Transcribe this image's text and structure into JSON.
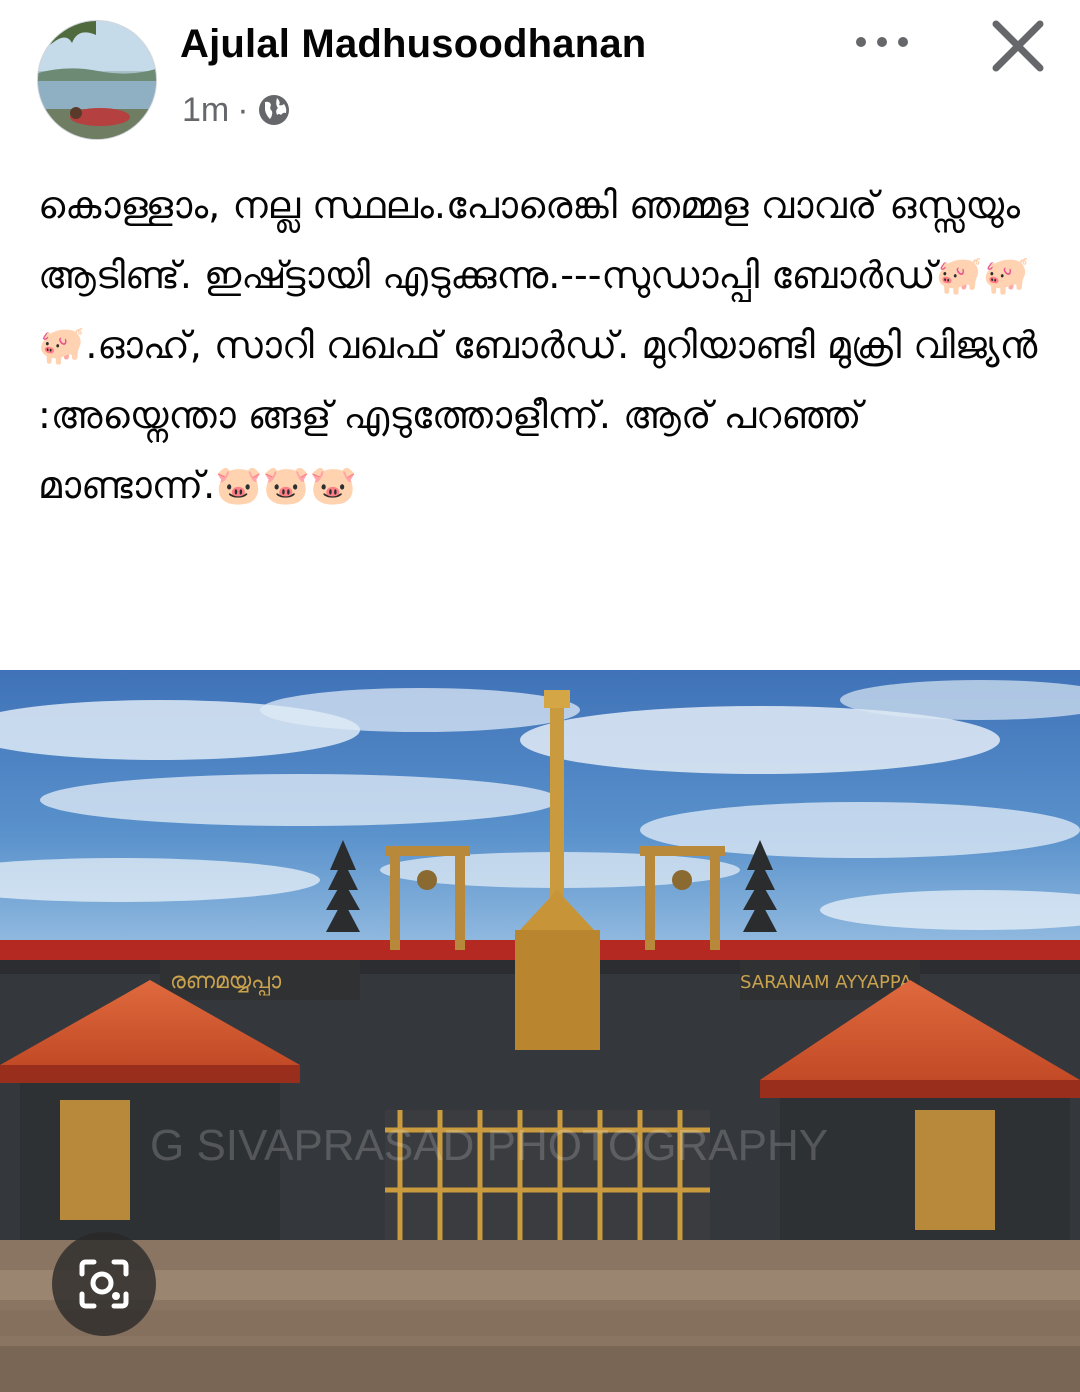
{
  "post": {
    "author": "Ajulal Madhusoodhanan",
    "time": "1m",
    "separator": "·",
    "privacy_icon": "globe-icon",
    "more_icon": "more-options-icon",
    "close_icon": "close-icon",
    "text": "കൊള്ളാം, നല്ല സ്ഥലം.പോരെങ്കി ഞമ്മള വാവര് ഒസ്സയും ആടിണ്ട്. ഇഷ്ട്ടായി എടുക്കുന്നു.---സുഡാപ്പി ബോർഡ്🐖🐖🐖.ഓഹ്, സാറി വഖഫ് ബോർഡ്. മുറിയാണ്ടി മുക്രി വിജ്യൻ :അയ്നെന്താ ങ്ങള് എടുത്തോളീന്ന്. ആര് പറഞ്ഞ് മാണ്ടാന്ന്.🐷🐷🐷"
  },
  "image": {
    "sign_left": "രണമയ്യപ്പാ",
    "sign_right": "SARANAM AYYAPPA",
    "watermark": "G SIVAPRASAD PHOTOGRAPHY",
    "lens_icon": "visual-search-lens-icon"
  }
}
